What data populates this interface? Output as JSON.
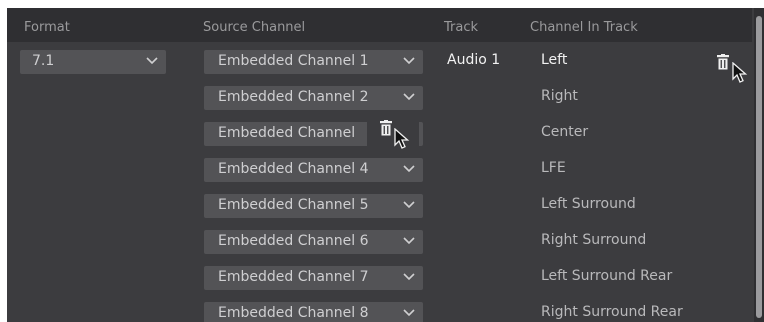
{
  "header": {
    "format": "Format",
    "source_channel": "Source Channel",
    "track": "Track",
    "channel_in_track": "Channel In Track"
  },
  "format_select": {
    "value": "7.1"
  },
  "track": "Audio 1",
  "rows": [
    {
      "source": "Embedded Channel 1",
      "channel": "Left"
    },
    {
      "source": "Embedded Channel 2",
      "channel": "Right"
    },
    {
      "source": "Embedded Channel",
      "channel": "Center"
    },
    {
      "source": "Embedded Channel 4",
      "channel": "LFE"
    },
    {
      "source": "Embedded Channel 5",
      "channel": "Left Surround"
    },
    {
      "source": "Embedded Channel 6",
      "channel": "Right Surround"
    },
    {
      "source": "Embedded Channel 7",
      "channel": "Left Surround Rear"
    },
    {
      "source": "Embedded Channel 8",
      "channel": "Right Surround Rear"
    }
  ],
  "icons": {
    "chevron": "chevron-down-icon",
    "trash": "trash-icon",
    "cursor": "mouse-pointer-icon"
  },
  "colors": {
    "panel": "#3c3c3f",
    "header": "#2f2f32",
    "dropdown": "#535356",
    "text_primary": "#f2f2f2",
    "text_secondary": "#b9b9bb"
  }
}
